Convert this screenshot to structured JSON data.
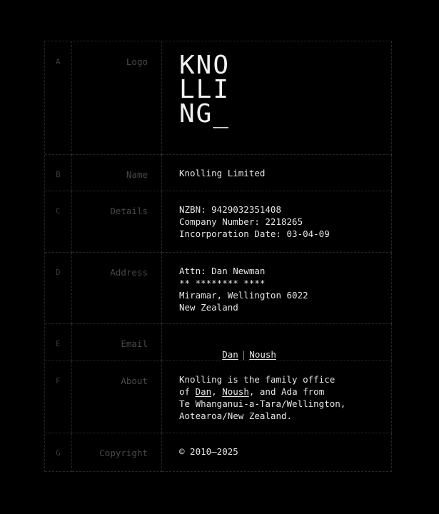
{
  "rows": [
    {
      "letter": "A",
      "label": "Logo"
    },
    {
      "letter": "B",
      "label": "Name"
    },
    {
      "letter": "C",
      "label": "Details"
    },
    {
      "letter": "D",
      "label": "Address"
    },
    {
      "letter": "E",
      "label": "Email"
    },
    {
      "letter": "F",
      "label": "About"
    },
    {
      "letter": "G",
      "label": "Copyright"
    }
  ],
  "logo": {
    "lines": [
      "KNO",
      "LLI",
      "NG_"
    ]
  },
  "name": "Knolling Limited",
  "details": {
    "nzbn": "NZBN: 9429032351408",
    "company_number": "Company Number: 2218265",
    "incorporation": "Incorporation Date: 03-04-09"
  },
  "address": {
    "attn": "Attn: Dan Newman",
    "masked": "** ******** ****",
    "city": "Miramar, Wellington 6022",
    "country": "New Zealand"
  },
  "email": {
    "dan": "Dan",
    "separator": "|",
    "noush": "Noush"
  },
  "about": {
    "line1": "Knolling is the family office",
    "line2_prefix": "of ",
    "dan": "Dan",
    "comma": ", ",
    "noush": "Noush",
    "line2_suffix": ", and Ada from",
    "line3": "Te Whanganui-a-Tara/Wellington,",
    "line4": "Aotearoa/New Zealand."
  },
  "copyright": "© 2010–2025",
  "colors": {
    "background": "#000000",
    "text": "#e6e6e6",
    "muted": "#494949",
    "grid": "#262626"
  }
}
